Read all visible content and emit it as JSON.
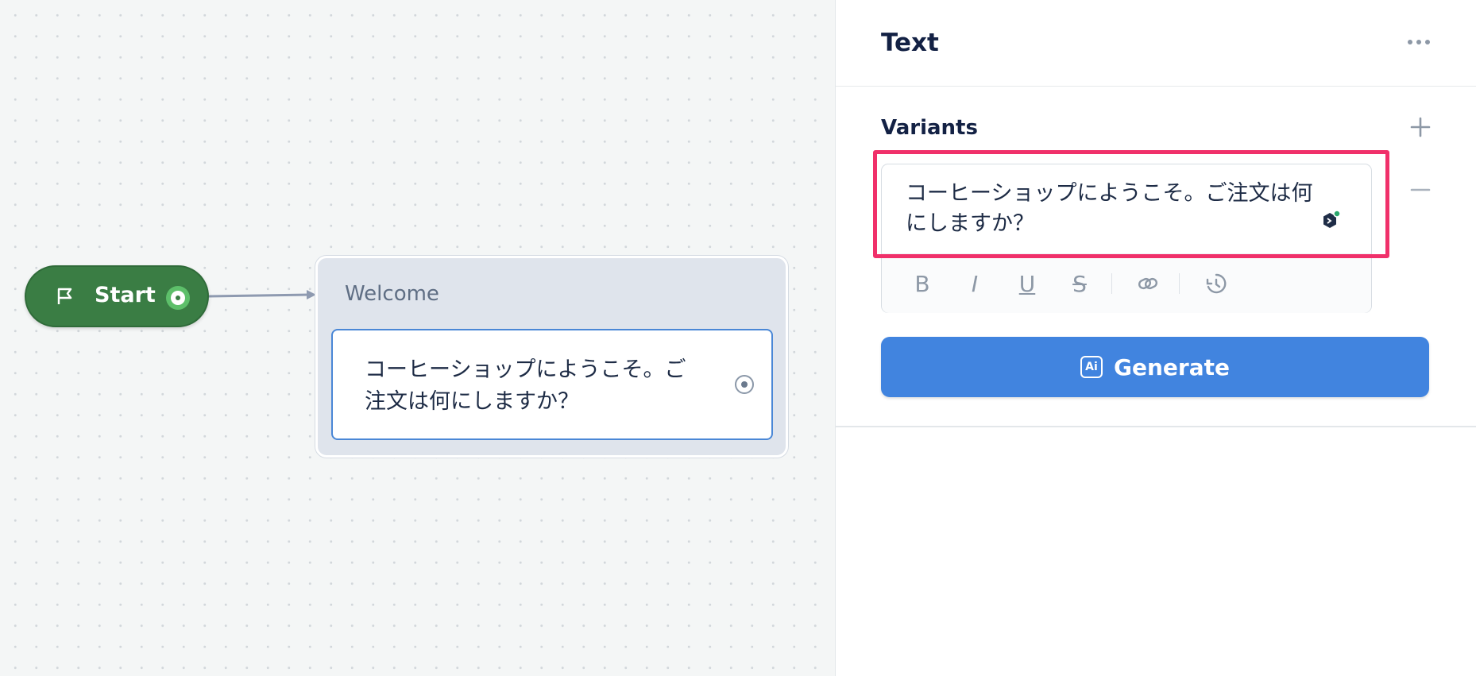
{
  "canvas": {
    "start_node": {
      "label": "Start",
      "icon": "flag-icon"
    },
    "block": {
      "title": "Welcome",
      "step_text": "コーヒーショップにようこそ。ご注文は何にしますか？"
    }
  },
  "panel": {
    "title": "Text",
    "more_icon": "ellipsis-icon",
    "variants": {
      "title": "Variants",
      "text": "コーヒーショップにようこそ。ご注文は何にしますか？"
    },
    "toolbar": {
      "bold": "B",
      "italic": "I",
      "underline": "U",
      "strike": "S"
    },
    "generate": {
      "label": "Generate",
      "icon_text": "Ai"
    }
  },
  "colors": {
    "start_green": "#3a7d44",
    "accent_blue": "#4184df",
    "highlight_pink": "#f0306a"
  }
}
